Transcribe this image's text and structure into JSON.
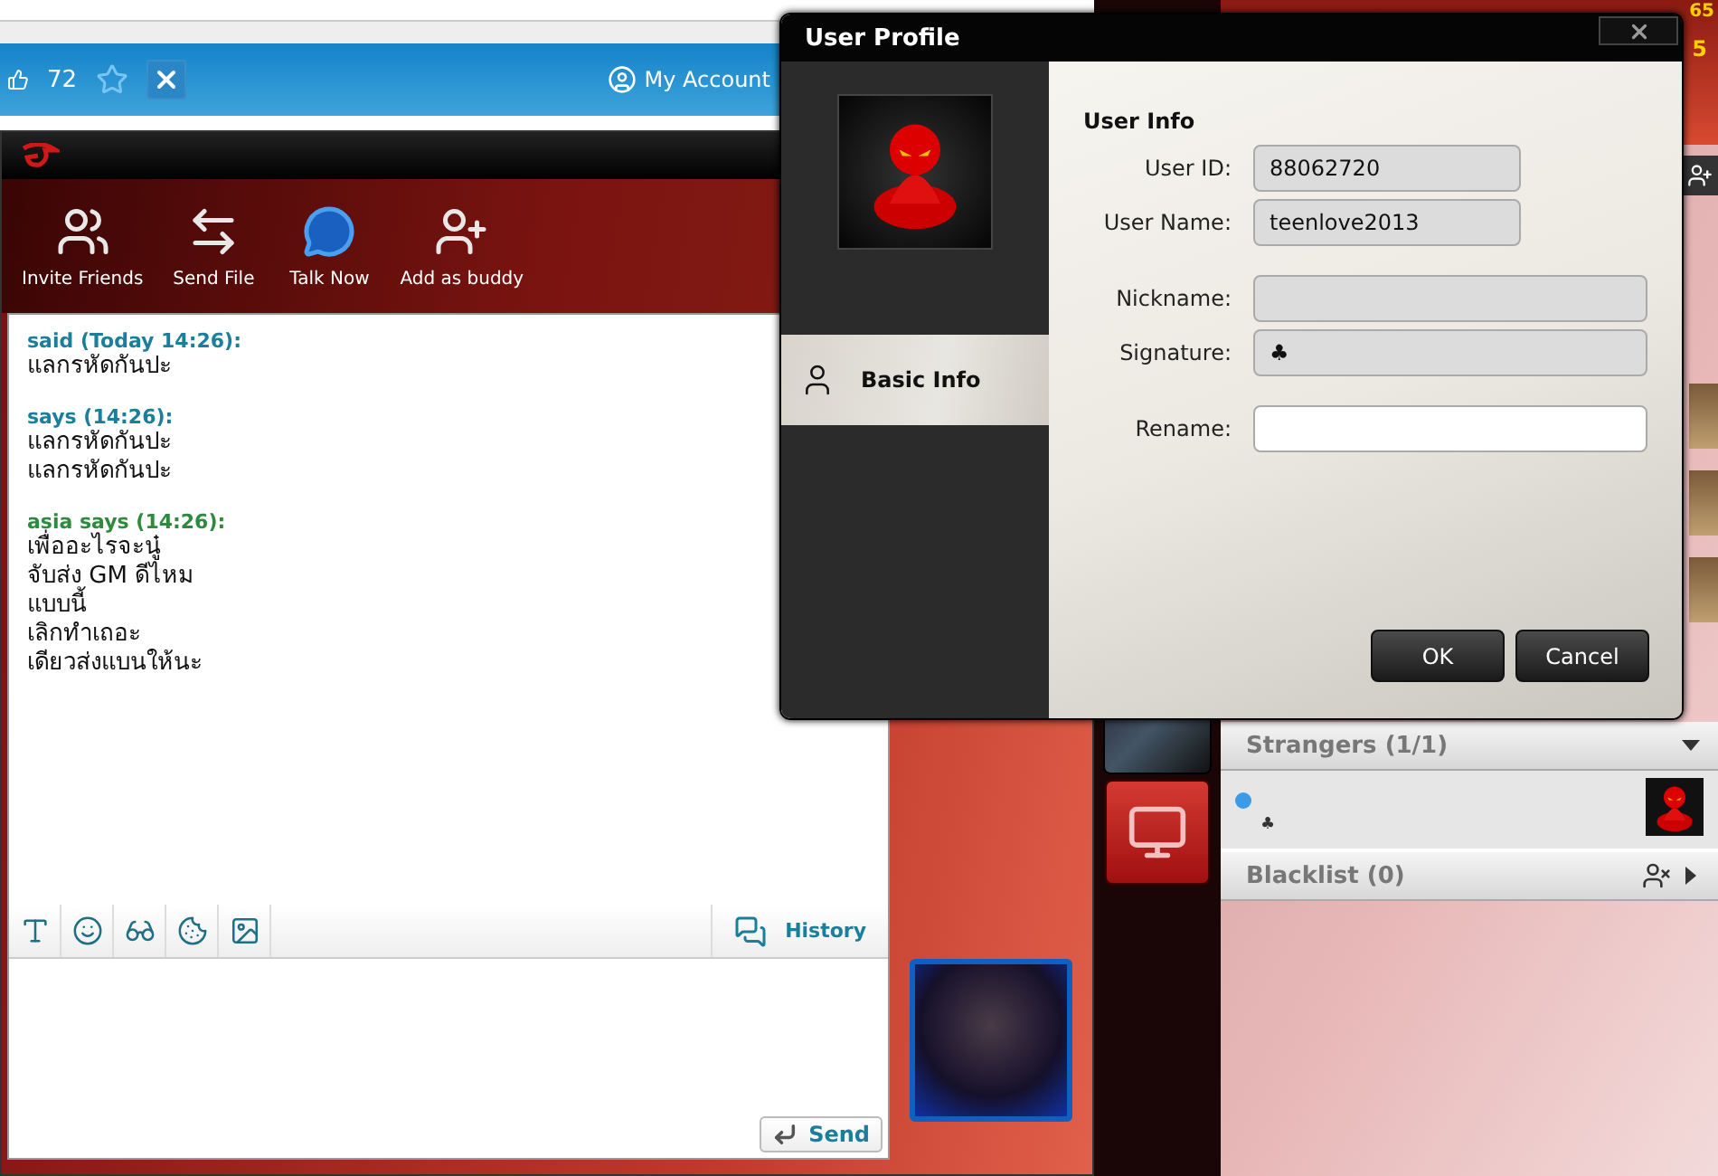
{
  "browser": {
    "count": "72",
    "account": "My Account"
  },
  "chat": {
    "toolbar": [
      {
        "kind": "invite",
        "label": "Invite Friends"
      },
      {
        "kind": "send_file",
        "label": "Send File"
      },
      {
        "kind": "talk",
        "label": "Talk Now"
      },
      {
        "kind": "add_buddy",
        "label": "Add as buddy"
      }
    ],
    "messages": [
      {
        "header": "said (Today 14:26):",
        "color": "#1b7f9c",
        "lines": [
          "แลกรหัดกันปะ"
        ]
      },
      {
        "header": "says (14:26):",
        "color": "#1b7f9c",
        "lines": [
          "แลกรหัดกันปะ",
          "แลกรหัดกันปะ"
        ]
      },
      {
        "header": "asia says (14:26):",
        "color": "#2e8b3e",
        "lines": [
          "เพื่ออะไรจะนู๋",
          "จับส่ง GM ดีไหม",
          "แบบนี้",
          "เลิกทำเถอะ",
          "เดียวส่งแบนให้นะ"
        ]
      }
    ],
    "tools": [
      {
        "kind": "font"
      },
      {
        "kind": "emoticon"
      },
      {
        "kind": "face"
      },
      {
        "kind": "wink"
      },
      {
        "kind": "image"
      }
    ],
    "history": "History",
    "send": "Send"
  },
  "client": {
    "level": "65",
    "coins": "5",
    "groups": [
      {
        "kind": "contacts",
        "title": "Strangers (1/1)",
        "expanded": true,
        "members": [
          {
            "signature": "♣",
            "color": "#3a9be8"
          }
        ]
      },
      {
        "kind": "blacklist",
        "title": "Blacklist (0)",
        "expanded": false
      }
    ]
  },
  "dialog": {
    "title": "User Profile",
    "tabs": [
      {
        "label": "Basic Info",
        "selected": true
      }
    ],
    "section": "User Info",
    "groups": [
      [
        {
          "label": "User ID:",
          "value": "88062720",
          "editable": false
        },
        {
          "label": "User Name:",
          "value": "teenlove2013",
          "editable": false
        }
      ],
      [
        {
          "label": "Nickname:",
          "editable": false
        },
        {
          "label": "Signature:",
          "value": "♣",
          "editable": false
        }
      ],
      [
        {
          "label": "Rename:",
          "editable": true
        }
      ]
    ],
    "buttons": [
      "OK",
      "Cancel"
    ]
  }
}
